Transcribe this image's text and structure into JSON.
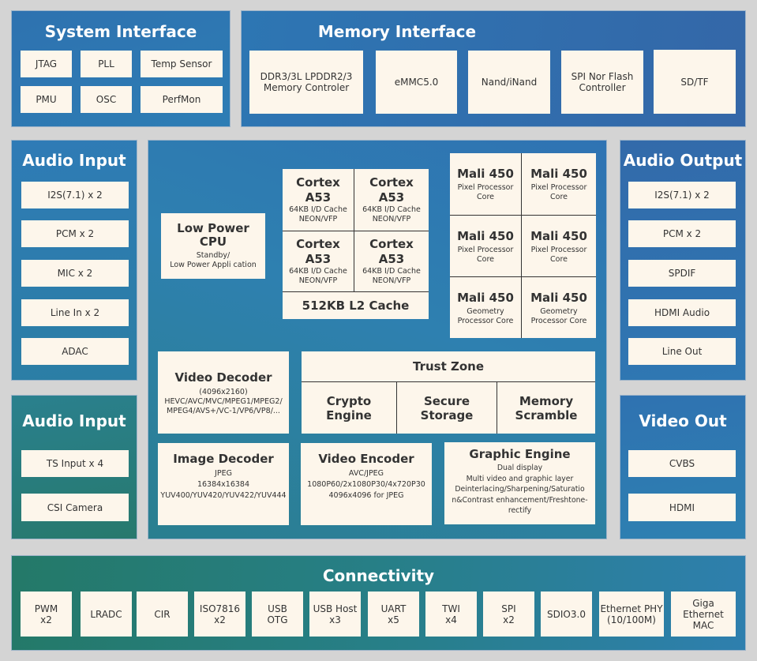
{
  "colors": {
    "page_background": "#d4d4d4",
    "block_fill": "#fdf6eb",
    "block_text": "#333333",
    "panel_title": "#ffffff",
    "blue_panel": "#2e78b3",
    "teal_panel": "#277a70"
  },
  "system_interface": {
    "title": "System Interface",
    "items": [
      "JTAG",
      "PLL",
      "Temp Sensor",
      "PMU",
      "OSC",
      "PerfMon"
    ]
  },
  "memory_interface": {
    "title": "Memory Interface",
    "items": [
      "DDR3/3L LPDDR2/3\nMemory Controler",
      "eMMC5.0",
      "Nand/iNand",
      "SPI Nor Flash\nController",
      "SD/TF"
    ]
  },
  "audio_input": {
    "title": "Audio  Input",
    "items": [
      "I2S(7.1) x 2",
      "PCM x 2",
      "MIC x 2",
      "Line In x 2",
      "ADAC"
    ]
  },
  "ts_input": {
    "title": "Audio  Input",
    "items": [
      "TS Input x 4",
      "CSI Camera"
    ]
  },
  "audio_output": {
    "title": "Audio  Output",
    "items": [
      "I2S(7.1) x 2",
      "PCM x 2",
      "SPDIF",
      "HDMI Audio",
      "Line Out"
    ]
  },
  "video_out": {
    "title": "Video Out",
    "items": [
      "CVBS",
      "HDMI"
    ]
  },
  "core": {
    "low_power_cpu": {
      "title": "Low Power\nCPU",
      "desc": "Standby/\nLow Power Appli cation"
    },
    "cortex": [
      {
        "title": "Cortex\nA53",
        "desc": "64KB I/D Cache\nNEON/VFP"
      },
      {
        "title": "Cortex\nA53",
        "desc": "64KB I/D Cache\nNEON/VFP"
      },
      {
        "title": "Cortex\nA53",
        "desc": "64KB I/D Cache\nNEON/VFP"
      },
      {
        "title": "Cortex\nA53",
        "desc": "64KB I/D Cache\nNEON/VFP"
      }
    ],
    "l2_cache": "512KB L2 Cache",
    "mali": [
      {
        "title": "Mali 450",
        "desc": "Pixel Processor\nCore"
      },
      {
        "title": "Mali 450",
        "desc": "Pixel Processor\nCore"
      },
      {
        "title": "Mali 450",
        "desc": "Pixel Processor\nCore"
      },
      {
        "title": "Mali 450",
        "desc": "Pixel Processor\nCore"
      },
      {
        "title": "Mali 450",
        "desc": "Geometry\nProcessor Core"
      },
      {
        "title": "Mali 450",
        "desc": "Geometry\nProcessor Core"
      }
    ],
    "video_decoder": {
      "title": "Video Decoder",
      "desc": "(4096x2160)\nHEVC/AVC/MVC/MPEG1/MPEG2/\nMPEG4/AVS+/VC-1/VP6/VP8/..."
    },
    "trust_zone": {
      "title": "Trust Zone",
      "items": [
        "Crypto\nEngine",
        "Secure\nStorage",
        "Memory\nScramble"
      ]
    },
    "image_decoder": {
      "title": "Image Decoder",
      "desc": "JPEG\n16384x16384\nYUV400/YUV420/YUV422/YUV444"
    },
    "video_encoder": {
      "title": "Video Encoder",
      "desc": "AVC/JPEG\n1080P60/2x1080P30/4x720P30\n4096x4096 for JPEG"
    },
    "graphic_engine": {
      "title": "Graphic Engine",
      "desc": "Dual display\nMulti video and graphic layer\nDeinterlacing/Sharpening/Saturatio\nn&Contrast enhancement/Freshtone-\nrectify"
    }
  },
  "connectivity": {
    "title": "Connectivity",
    "items": [
      "PWM\nx2",
      "LRADC",
      "CIR",
      "ISO7816\nx2",
      "USB\nOTG",
      "USB Host\nx3",
      "UART\nx5",
      "TWI\nx4",
      "SPI\nx2",
      "SDIO3.0",
      "Ethernet PHY\n(10/100M)",
      "Giga Ethernet\nMAC"
    ]
  }
}
